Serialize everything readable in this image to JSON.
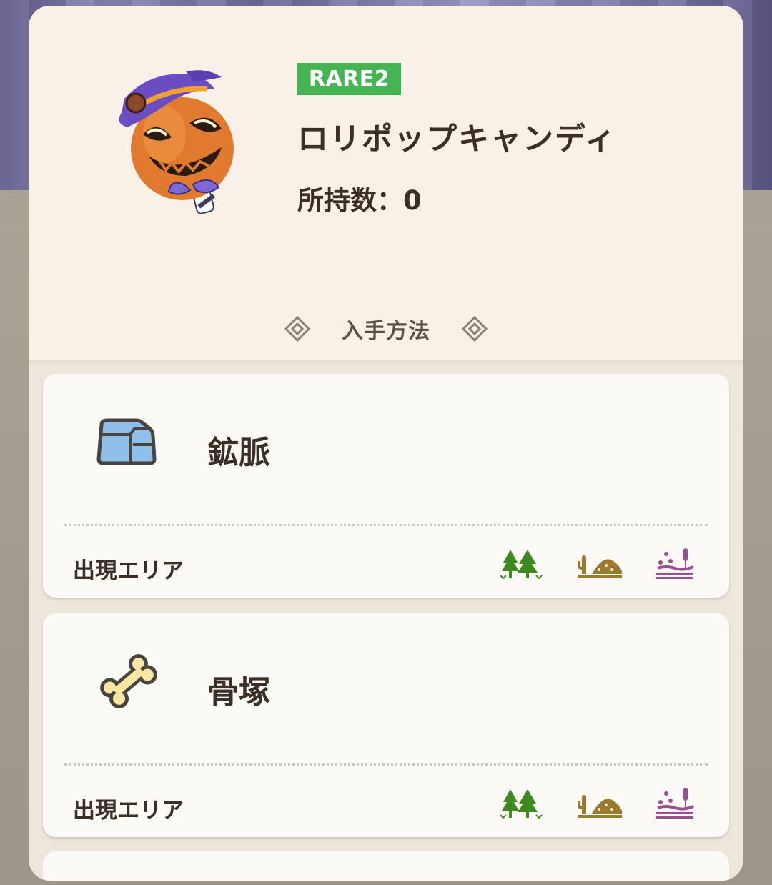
{
  "item": {
    "rarity": "RARE2",
    "name": "ロリポップキャンディ",
    "owned_label": "所持数：0"
  },
  "acquisition": {
    "title": "入手方法"
  },
  "sources": [
    {
      "title": "鉱脈",
      "icon": "ore-vein-icon",
      "area_label": "出現エリア",
      "areas": [
        "forest-area-icon",
        "desert-area-icon",
        "swamp-area-icon"
      ]
    },
    {
      "title": "骨塚",
      "icon": "bone-pile-icon",
      "area_label": "出現エリア",
      "areas": [
        "forest-area-icon",
        "desert-area-icon",
        "swamp-area-icon"
      ]
    }
  ],
  "colors": {
    "rarity_badge": "#45b553",
    "forest": "#3f8a1e",
    "desert": "#9a7a2e",
    "swamp": "#9b4f8e",
    "text_dark": "#3a2e25"
  }
}
